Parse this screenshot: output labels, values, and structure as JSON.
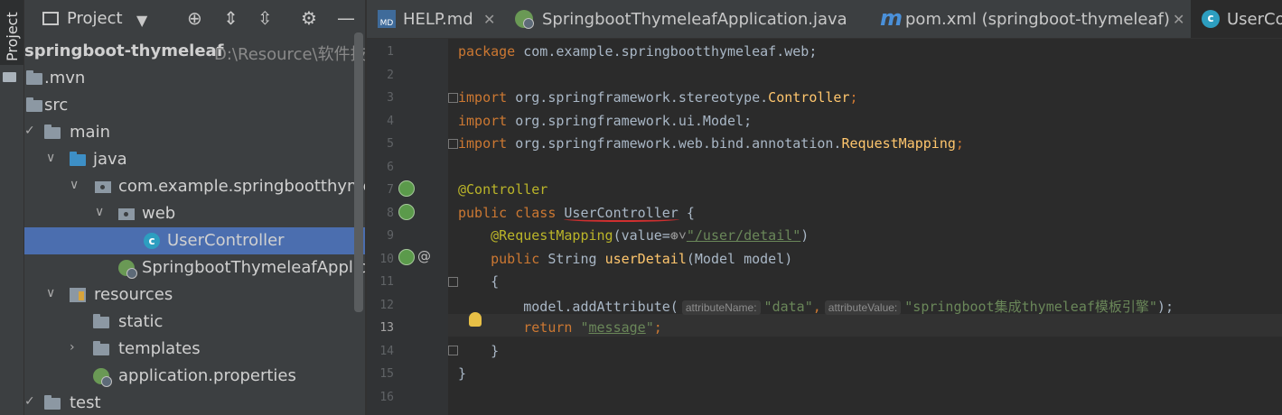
{
  "sidebar_strip": {
    "tab_label": "Project"
  },
  "project_panel": {
    "title": "Project",
    "tree": [
      {
        "label": "springboot-thymeleaf",
        "path": "D:\\Resource\\软件技术"
      },
      {
        "label": ".mvn"
      },
      {
        "label": "src"
      },
      {
        "label": "main"
      },
      {
        "label": "java"
      },
      {
        "label": "com.example.springbootthymel"
      },
      {
        "label": "web"
      },
      {
        "label": "UserController"
      },
      {
        "label": "SpringbootThymeleafApplica"
      },
      {
        "label": "resources"
      },
      {
        "label": "static"
      },
      {
        "label": "templates"
      },
      {
        "label": "application.properties"
      },
      {
        "label": "test"
      }
    ]
  },
  "tabs": [
    {
      "label": "HELP.md",
      "icon": "markdown-icon"
    },
    {
      "label": "SpringbootThymeleafApplication.java",
      "icon": "spring-boot-icon"
    },
    {
      "label": "pom.xml (springboot-thymeleaf)",
      "icon": "maven-icon",
      "icon_text": "m"
    },
    {
      "label": "UserCo",
      "icon": "class-icon",
      "active": true
    }
  ],
  "editor": {
    "line_numbers": [
      "1",
      "2",
      "3",
      "4",
      "5",
      "6",
      "7",
      "8",
      "9",
      "10",
      "11",
      "12",
      "13",
      "14",
      "15",
      "16"
    ],
    "current_line": "13",
    "tokens": {
      "package_kw": "package",
      "package_name": " com.example.springbootthymeleaf.web;",
      "import_kw": "import",
      "imp1_a": " org.springframework.stereotype.",
      "imp1_b": "Controller",
      "imp1_c": ";",
      "imp2": " org.springframework.ui.Model;",
      "imp3_a": " org.springframework.web.bind.annotation.",
      "imp3_b": "RequestMapping",
      "imp3_c": ";",
      "ann_controller": "@Controller",
      "public_kw": "public",
      "class_kw": "class",
      "class_name": "UserController",
      "brace_open": " {",
      "ann_request": "@RequestMapping",
      "req_args_a": "(value=",
      "req_value": "\"/user/detail\"",
      "req_args_b": ")",
      "method_ret": " String ",
      "method_name": "userDetail",
      "method_params": "(Model model)",
      "block_open": "{",
      "call_a": "model.addAttribute(",
      "hint1": "attributeName:",
      "arg1": "\"data\"",
      "comma": ",",
      "hint2": "attributeValue:",
      "arg2": "\"springboot集成thymeleaf模板引擎\"",
      "call_end": ");",
      "return_kw": "return",
      "ret_q1": "\"",
      "ret_val": "message",
      "ret_q2": "\"",
      "semi": ";",
      "block_close": "}",
      "class_close": "}"
    }
  }
}
